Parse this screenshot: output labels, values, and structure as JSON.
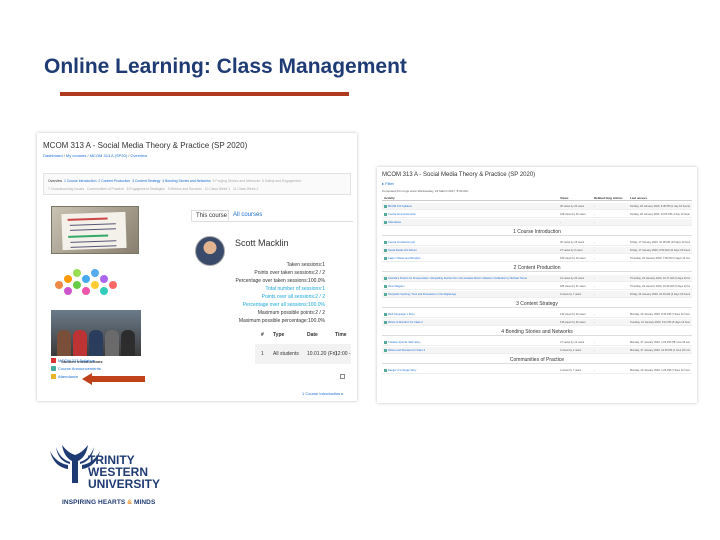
{
  "slide": {
    "title": "Online Learning: Class Management"
  },
  "colors": {
    "title_navy": "#1f3b73",
    "rule_red": "#b03a1d",
    "link_blue": "#1a6ed1",
    "highlight_cyan": "#1aa7d6",
    "arrow_orange": "#c0401a",
    "accent_orange": "#e88a1a"
  },
  "left_screenshot": {
    "course_title": "MCOM 313 A - Social Media Theory & Practice (SP 2020)",
    "breadcrumb": [
      "Dashboard",
      "My courses",
      "MCOM 313 A (SP20)",
      "Overview"
    ],
    "nav_row_1": [
      "Overview",
      "1 Course Introduction",
      "2 Content Production",
      "3 Content Strategy",
      "4 Bonding Stories and Networks",
      "5 Forging Stories and Networks",
      "6 Safety and Engagement"
    ],
    "nav_row_2": [
      "7 Crowdsourcing Issues",
      "Communities of Practice",
      "8 Engagement Strategies",
      "9 Metrics and Success",
      "10 Class Week 1",
      "11 Class Week 2"
    ],
    "student_caption": "Student Introductions",
    "links": [
      {
        "label": "MCOM 313 Syllabus",
        "icon": "pdf-icon"
      },
      {
        "label": "Course Announcements",
        "icon": "forum-icon"
      },
      {
        "label": "Attendance",
        "icon": "attendance-icon"
      }
    ],
    "tabs": {
      "active": "This course",
      "other": "All courses"
    },
    "student_name": "Scott Macklin",
    "stats": [
      {
        "text": "Taken sessions:1",
        "highlight": false
      },
      {
        "text": "Points over taken sessions:2 / 2",
        "highlight": false
      },
      {
        "text": "Percentage over taken sessions:100.0%",
        "highlight": false
      },
      {
        "text": "Total number of sessions:1",
        "highlight": true
      },
      {
        "text": "Points over all sessions:2 / 2",
        "highlight": true
      },
      {
        "text": "Percentage over all sessions:100.0%",
        "highlight": true
      },
      {
        "text": "Maximum possible points:2 / 2",
        "highlight": false
      },
      {
        "text": "Maximum possible percentage:100.0%",
        "highlight": false
      }
    ],
    "table": {
      "headers": [
        "#",
        "Type",
        "Date",
        "Time"
      ],
      "row": [
        "1",
        "All students",
        "10.01.20 (Fri)",
        "12:00 - 15:00"
      ]
    },
    "next_link": "1 Course Introduction ▸"
  },
  "right_screenshot": {
    "title": "MCOM 313 A - Social Media Theory & Practice (SP 2020)",
    "filter_label": "▸ Filter",
    "computed_note": "Computed from logs since Wednesday, 22 March 2017, 8:30 AM.",
    "headers": [
      "Activity",
      "Views",
      "Related blog entries",
      "Last access"
    ],
    "rows": [
      {
        "type": "row",
        "name": "MCOM 313 Syllabus",
        "views": "30 views by 20 users",
        "blog": "-",
        "last": "Sunday, 26 January 2020, 3:38 PM (1 day 10 hours)"
      },
      {
        "type": "row",
        "name": "Course Announcements",
        "views": "169 views by 19 users",
        "blog": "-",
        "last": "Sunday, 26 January 2020, 12:06 PM (1 day 13 hours)"
      },
      {
        "type": "row",
        "name": "Attendance",
        "views": "-",
        "blog": "-",
        "last": ""
      },
      {
        "type": "section",
        "label": "1 Course Introduction"
      },
      {
        "type": "row",
        "name": "Course Introduction.ppt",
        "views": "30 views by 15 users",
        "blog": "-",
        "last": "Friday, 17 January 2020, 10:38 AM (10 days 23 hours)"
      },
      {
        "type": "row",
        "name": "Social Media 101 School",
        "views": "27 views by 9 users",
        "blog": "-",
        "last": "Friday, 17 January 2020, 9:50 AM (10 days 23 hours)"
      },
      {
        "type": "row",
        "name": "Class 1 Wows and Wonders",
        "views": "160 views by 19 users",
        "blog": "-",
        "last": "Thursday, 23 January 2020, 7:59 PM (4 days 14 hours)"
      },
      {
        "type": "section",
        "label": "2 Content Production"
      },
      {
        "type": "row",
        "name": "Aristotle's Poetics for Screenwriters: Storytelling Secrets from the Greatest Mind in Western Civilization by Michael Tierno",
        "views": "41 views by 20 users",
        "blog": "-",
        "last": "Thursday, 23 January 2020, 10:17 AM (4 days 23 hours)"
      },
      {
        "type": "row",
        "name": "Venn Diagram",
        "views": "185 views by 21 users",
        "blog": "-",
        "last": "Thursday, 23 January 2020, 10:40 AM (4 days 23 hours)"
      },
      {
        "type": "row",
        "name": "Storyteller Uprising: Trust and Persuasion in the Digital Age",
        "views": "9 views by 7 users",
        "blog": "-",
        "last": "Friday, 24 January 2020, 10:19 AM (3 days 23 hours)"
      },
      {
        "type": "section",
        "label": "3 Content Strategy"
      },
      {
        "type": "row",
        "name": "Web Campaign 1 Story",
        "views": "132 views by 20 users",
        "blog": "-",
        "last": "Monday, 20 January 2020, 8:43 PM (7 days 12 hours)"
      },
      {
        "type": "row",
        "name": "Wow's & Wonder's for Class 2",
        "views": "135 views by 20 users",
        "blog": "-",
        "last": "Tuesday, 21 January 2020, 9:11 PM (6 days 12 hours)"
      },
      {
        "type": "section",
        "label": "4 Bonding Stories and Networks"
      },
      {
        "type": "row",
        "name": "Creative Journal: Web Story",
        "views": "47 views by 14 users",
        "blog": "-",
        "last": "Monday, 27 January 2020, 1:06 PM (58 mins 36 secs)"
      },
      {
        "type": "row",
        "name": "Waves and Wonders for Class 3",
        "views": "3 views by 2 users",
        "blog": "-",
        "last": "Monday, 27 January 2020, 12:45 PM (1 hour 20 mins)"
      },
      {
        "type": "section",
        "label": "Communities of Practice"
      },
      {
        "type": "row",
        "name": "Danger of a Single Story",
        "views": "4 views by 7 users",
        "blog": "-",
        "last": "Monday, 20 January 2020, 1:26 PM (7 days 12 hours)"
      }
    ]
  },
  "logo": {
    "line1": "TRINITY",
    "line2": "WESTERN",
    "line3": "UNIVERSITY",
    "tagline_a": "INSPIRING HEARTS ",
    "tagline_amp": "&",
    "tagline_b": " MINDS"
  }
}
